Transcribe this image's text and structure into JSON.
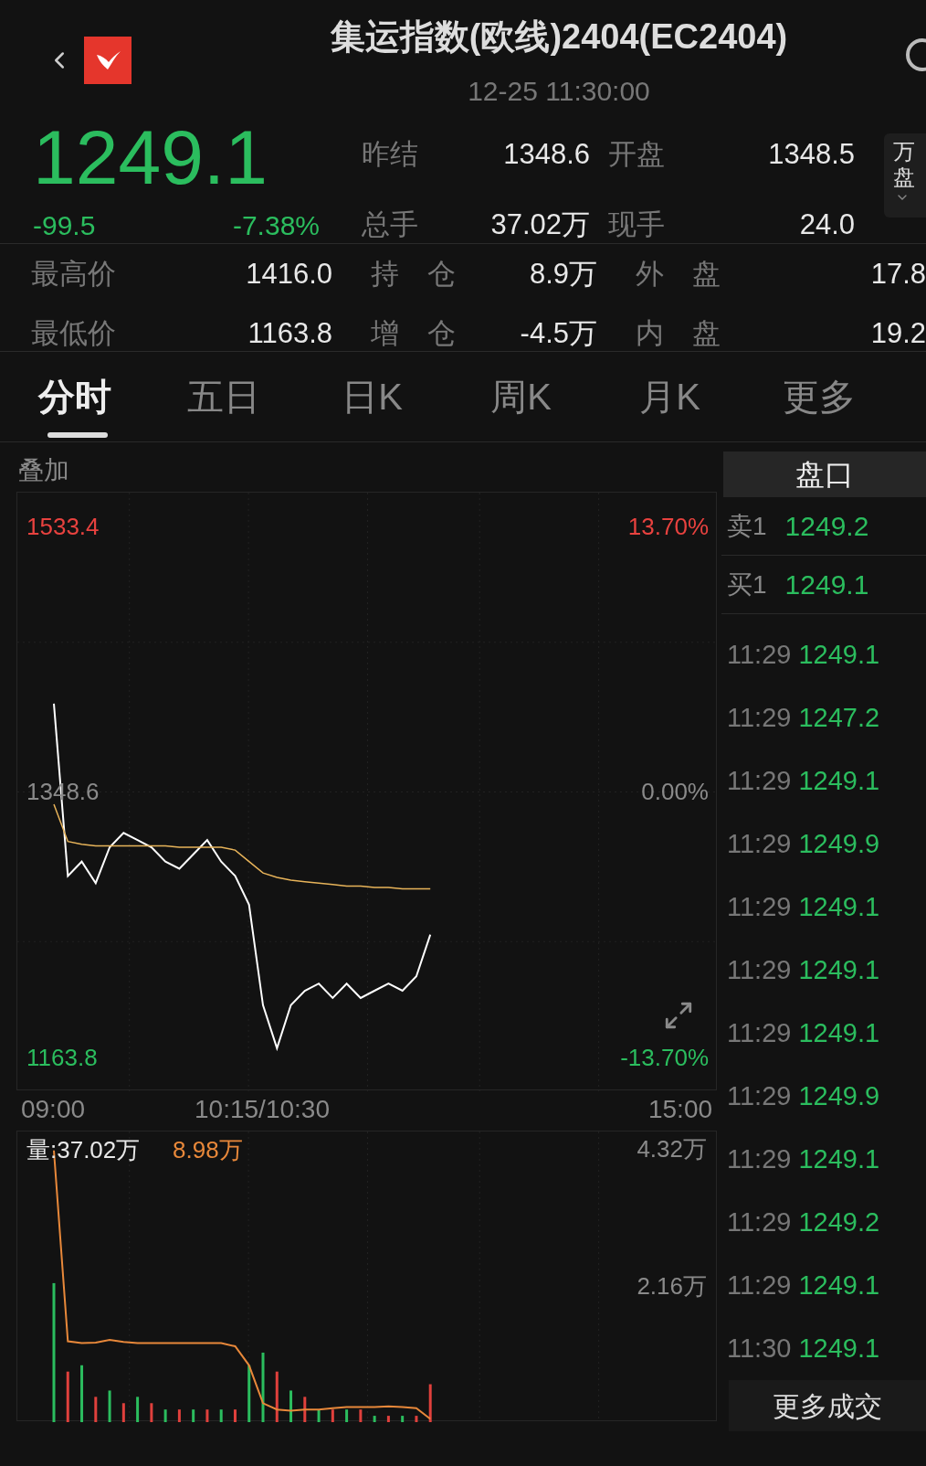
{
  "header": {
    "title": "集运指数(欧线)2404(EC2404)",
    "time": "12-25 11:30:00"
  },
  "quote": {
    "price": "1249.1",
    "change": "-99.5",
    "change_pct": "-7.38%"
  },
  "summary": [
    {
      "label": "昨结",
      "value": "1348.6"
    },
    {
      "label": "开盘",
      "value": "1348.5"
    },
    {
      "label": "总手",
      "value": "37.02万"
    },
    {
      "label": "现手",
      "value": "24.0"
    }
  ],
  "side_tab": {
    "lines": [
      "万",
      "盘"
    ]
  },
  "stats": [
    {
      "label": "最高价",
      "value": "1416.0"
    },
    {
      "label": "持　仓",
      "value": "8.9万"
    },
    {
      "label": "外　盘",
      "value": "17.8"
    },
    {
      "label": "最低价",
      "value": "1163.8"
    },
    {
      "label": "增　仓",
      "value": "-4.5万"
    },
    {
      "label": "内　盘",
      "value": "19.2"
    }
  ],
  "tabs": [
    {
      "label": "分时",
      "selected": true
    },
    {
      "label": "五日",
      "selected": false
    },
    {
      "label": "日K",
      "selected": false
    },
    {
      "label": "周K",
      "selected": false
    },
    {
      "label": "月K",
      "selected": false
    },
    {
      "label": "更多",
      "selected": false
    }
  ],
  "overlay_label": "叠加",
  "price_chart": {
    "percent_labels": [
      {
        "text": "13.70%",
        "kind": "up"
      },
      {
        "text": "0.00%",
        "kind": "flat"
      },
      {
        "text": "-13.70%",
        "kind": "down"
      }
    ],
    "chart_data": {
      "type": "line",
      "categories": [
        "09:00",
        null,
        null,
        null,
        null,
        null,
        null,
        null,
        null,
        null,
        null,
        null,
        null,
        null,
        null,
        "10:15/10:30",
        null,
        null,
        null,
        null,
        null,
        null,
        null,
        null,
        null,
        null,
        null,
        null,
        null,
        null,
        null,
        null,
        null,
        null,
        null,
        null,
        null,
        null,
        null,
        null,
        null,
        null,
        null,
        null,
        null,
        "15:00"
      ],
      "series": [
        {
          "color": "#ffffff",
          "values": [
            1410,
            1290,
            1300,
            1285,
            1310,
            1320,
            1315,
            1310,
            1300,
            1295,
            1305,
            1315,
            1300,
            1290,
            1270,
            1200,
            1170,
            1200,
            1210,
            1215,
            1205,
            1215,
            1205,
            1210,
            1215,
            1210,
            1220,
            1249.1,
            null,
            null,
            null,
            null,
            null,
            null,
            null,
            null,
            null,
            null,
            null,
            null,
            null,
            null,
            null,
            null,
            null,
            null
          ]
        },
        {
          "color": "#e8b45a",
          "values": [
            1340,
            1314,
            1312,
            1311,
            1311,
            1311,
            1311,
            1311,
            1311,
            1310,
            1310,
            1310,
            1310,
            1308,
            1300,
            1292,
            1289,
            1287,
            1286,
            1285,
            1284,
            1283,
            1283,
            1282,
            1282,
            1281,
            1281,
            1281,
            null,
            null,
            null,
            null,
            null,
            null,
            null,
            null,
            null,
            null,
            null,
            null,
            null,
            null,
            null,
            null,
            null,
            null
          ]
        }
      ],
      "ylim": [
        1140,
        1557
      ],
      "yticks": [
        {
          "value": 1533.4,
          "label": "1533.4"
        },
        {
          "value": 1348.6,
          "label": "1348.6"
        },
        {
          "value": 1163.8,
          "label": "1163.8"
        }
      ]
    }
  },
  "volume_chart": {
    "volume_label": "量:37.02万",
    "interest_label": "8.98万",
    "chart_data": {
      "type": "bar",
      "categories": [
        null,
        null,
        null,
        null,
        null,
        null,
        null,
        null,
        null,
        null,
        null,
        null,
        null,
        null,
        null,
        null,
        null,
        null,
        null,
        null,
        null,
        null,
        null,
        null,
        null,
        null,
        null,
        null,
        null,
        null,
        null,
        null,
        null,
        null,
        null,
        null,
        null,
        null,
        null,
        null,
        null,
        null,
        null,
        null,
        null,
        null
      ],
      "series": [
        {
          "color": "#e0403c",
          "values": [
            null,
            0.8,
            null,
            0.4,
            null,
            0.3,
            null,
            0.3,
            null,
            0.2,
            null,
            0.2,
            null,
            0.2,
            null,
            null,
            0.8,
            null,
            0.4,
            null,
            0.2,
            null,
            0.2,
            null,
            0.1,
            null,
            0.1,
            0.6,
            null,
            null,
            null,
            null,
            null,
            null,
            null,
            null,
            null,
            null,
            null,
            null,
            null,
            null,
            null,
            null,
            null,
            null
          ]
        },
        {
          "color": "#2bbd5e",
          "values": [
            2.2,
            null,
            0.9,
            null,
            0.5,
            null,
            0.4,
            null,
            0.2,
            null,
            0.2,
            null,
            0.2,
            null,
            0.9,
            1.1,
            null,
            0.5,
            null,
            0.2,
            null,
            0.2,
            null,
            0.1,
            null,
            0.1,
            null,
            null,
            null,
            null,
            null,
            null,
            null,
            null,
            null,
            null,
            null,
            null,
            null,
            null,
            null,
            null,
            null,
            null,
            null,
            null
          ]
        },
        {
          "type": "line",
          "color": "#e8883a",
          "values": [
            4.3,
            1.28,
            1.25,
            1.26,
            1.3,
            1.27,
            1.25,
            1.25,
            1.25,
            1.25,
            1.25,
            1.25,
            1.25,
            1.2,
            0.9,
            0.3,
            0.2,
            0.18,
            0.2,
            0.2,
            0.22,
            0.24,
            0.24,
            0.24,
            0.25,
            0.24,
            0.22,
            0.05,
            null,
            null,
            null,
            null,
            null,
            null,
            null,
            null,
            null,
            null,
            null,
            null,
            null,
            null,
            null,
            null,
            null,
            null
          ]
        }
      ],
      "ylim": [
        0,
        4.6
      ],
      "yticks": [
        {
          "value": 4.32,
          "label": "4.32万"
        },
        {
          "value": 2.16,
          "label": "2.16万"
        }
      ]
    }
  },
  "order_book": {
    "title": "盘口",
    "levels": [
      {
        "label": "卖1",
        "price": "1249.2"
      },
      {
        "label": "买1",
        "price": "1249.1"
      }
    ]
  },
  "trades": [
    {
      "time": "11:29",
      "price": "1249.1"
    },
    {
      "time": "11:29",
      "price": "1247.2"
    },
    {
      "time": "11:29",
      "price": "1249.1"
    },
    {
      "time": "11:29",
      "price": "1249.9"
    },
    {
      "time": "11:29",
      "price": "1249.1"
    },
    {
      "time": "11:29",
      "price": "1249.1"
    },
    {
      "time": "11:29",
      "price": "1249.1"
    },
    {
      "time": "11:29",
      "price": "1249.9"
    },
    {
      "time": "11:29",
      "price": "1249.1"
    },
    {
      "time": "11:29",
      "price": "1249.2"
    },
    {
      "time": "11:29",
      "price": "1249.1"
    },
    {
      "time": "11:30",
      "price": "1249.1"
    }
  ],
  "more_trades_button": "更多成交"
}
